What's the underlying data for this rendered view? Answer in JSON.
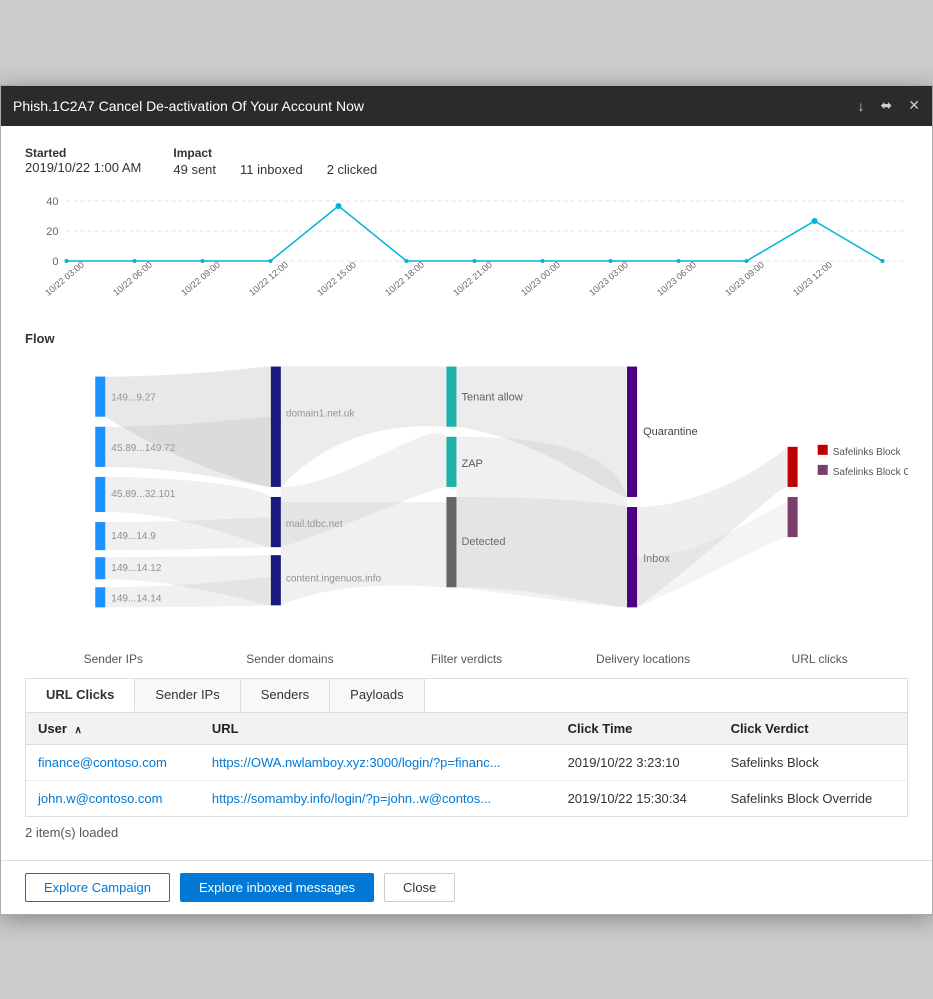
{
  "window": {
    "title": "Phish.1C2A7   Cancel De-activation Of Your Account Now",
    "controls": [
      "download-icon",
      "share-icon",
      "close-icon"
    ]
  },
  "meta": {
    "started_label": "Started",
    "started_value": "2019/10/22 1:00 AM",
    "impact_label": "Impact",
    "impact_sent": "49 sent",
    "impact_inboxed": "11 inboxed",
    "impact_clicked": "2 clicked"
  },
  "chart": {
    "y_labels": [
      "40",
      "20",
      "0"
    ],
    "x_labels": [
      "10/22 03:00",
      "10/22 06:00",
      "10/22 09:00",
      "10/22 12:00",
      "10/22 15:00",
      "10/22 18:00",
      "10/22 21:00",
      "10/23 00:00",
      "10/23 03:00",
      "10/23 06:00",
      "10/23 09:00",
      "10/23 12:00"
    ]
  },
  "flow": {
    "label": "Flow",
    "column_labels": [
      "Sender IPs",
      "Sender domains",
      "Filter verdicts",
      "Delivery locations",
      "URL clicks"
    ]
  },
  "legend": {
    "items": [
      {
        "label": "Safelinks Block",
        "color": "#c00000"
      },
      {
        "label": "Safelinks Block Override",
        "color": "#7b3f6e"
      }
    ]
  },
  "tabs": [
    {
      "label": "URL Clicks",
      "active": true
    },
    {
      "label": "Sender IPs",
      "active": false
    },
    {
      "label": "Senders",
      "active": false
    },
    {
      "label": "Payloads",
      "active": false
    }
  ],
  "table": {
    "columns": [
      {
        "label": "User",
        "sortable": true,
        "sort_dir": "asc"
      },
      {
        "label": "URL",
        "sortable": false
      },
      {
        "label": "Click Time",
        "sortable": false
      },
      {
        "label": "Click Verdict",
        "sortable": false
      }
    ],
    "rows": [
      {
        "user": "finance@contoso.com",
        "url": "https://OWA.nwlamboy.xyz:3000/login/?p=financ...",
        "click_time": "2019/10/22 3:23:10",
        "verdict": "Safelinks Block"
      },
      {
        "user": "john.w@contoso.com",
        "url": "https://somamby.info/login/?p=john..w@contos...",
        "click_time": "2019/10/22 15:30:34",
        "verdict": "Safelinks Block Override"
      }
    ]
  },
  "status": "2 item(s) loaded",
  "footer": {
    "explore_campaign": "Explore Campaign",
    "explore_inboxed": "Explore inboxed messages",
    "close": "Close"
  }
}
